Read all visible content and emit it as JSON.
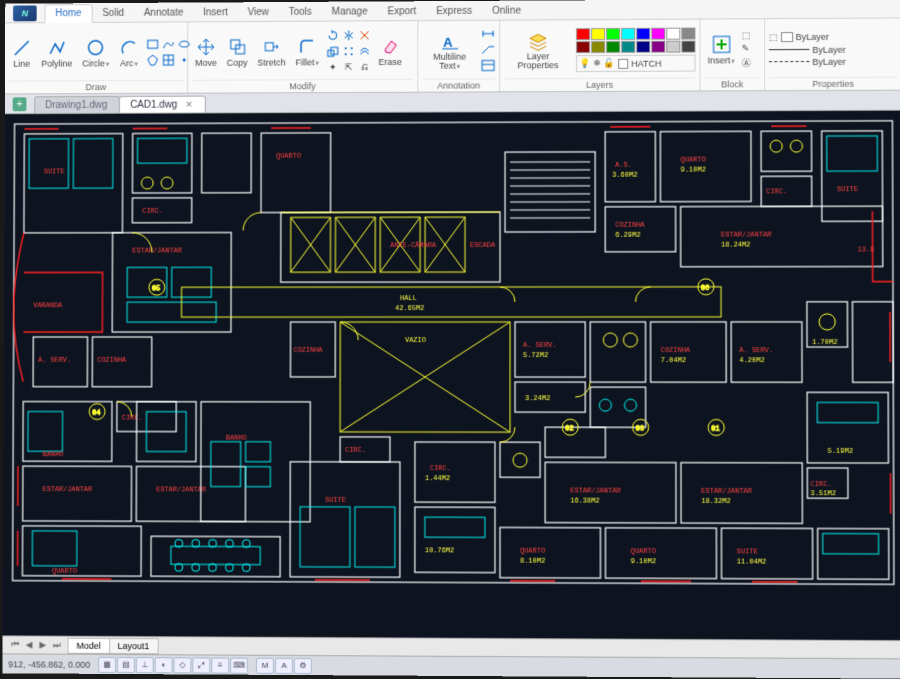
{
  "menu": {
    "tabs": [
      "Home",
      "Solid",
      "Annotate",
      "Insert",
      "View",
      "Tools",
      "Manage",
      "Export",
      "Express",
      "Online"
    ],
    "active": 0
  },
  "ribbon": {
    "draw": {
      "label": "Draw",
      "line": "Line",
      "polyline": "Polyline",
      "circle": "Circle",
      "arc": "Arc"
    },
    "modify": {
      "label": "Modify",
      "move": "Move",
      "copy": "Copy",
      "stretch": "Stretch",
      "fillet": "Fillet",
      "erase": "Erase"
    },
    "annotation": {
      "label": "Annotation",
      "mtext": "Multiline Text"
    },
    "layers": {
      "label": "Layers",
      "props": "Layer Properties",
      "hatch": "HATCH"
    },
    "block": {
      "label": "Block",
      "insert": "Insert"
    },
    "properties": {
      "label": "Properties",
      "bylayer": "ByLayer"
    }
  },
  "file_tabs": {
    "items": [
      {
        "name": "Drawing1.dwg",
        "active": false
      },
      {
        "name": "CAD1.dwg",
        "active": true
      }
    ]
  },
  "sheet_tabs": {
    "model": "Model",
    "layout": "Layout1"
  },
  "status": {
    "coords": "912, -456.862, 0.000"
  },
  "rooms": {
    "suite": "SUITE",
    "quarto": "QUARTO",
    "circ": "CIRC.",
    "estar": "ESTAR/JANTAR",
    "varanda": "VARANDA",
    "aserv": "A. SERV.",
    "cozinha": "COZINHA",
    "banho": "BANHO",
    "hall": "HALL",
    "hall_area": "42.65M2",
    "vazio": "VAZIO",
    "ante": "ANTE-CÂMARA",
    "escada": "ESCADA",
    "as": "A.S.",
    "gas": "",
    "q9": "9.10M2",
    "q18": "18.24M2",
    "q6": "6.29M2",
    "q5": "5.72M2",
    "q3": "3.60M2",
    "q7": "7.04M2",
    "q4": "4.20M2",
    "q17": "1.70M2",
    "q32": "3.24M2",
    "q14": "1.44M2",
    "q107": "10.76M2",
    "q163": "16.38M2",
    "q183": "18.32M2",
    "q810": "8.10M2",
    "q910": "9.10M2",
    "q1104": "11.04M2",
    "q351": "3.51M2",
    "q139": "13.9",
    "q519": "5.19M2"
  }
}
